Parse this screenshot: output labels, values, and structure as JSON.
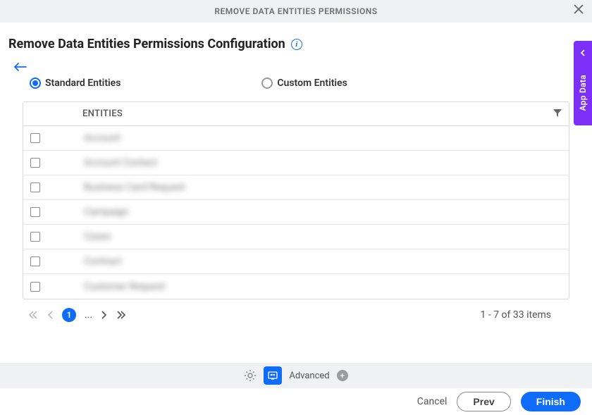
{
  "header": {
    "title": "REMOVE DATA ENTITIES PERMISSIONS"
  },
  "page": {
    "title": "Remove Data Entities Permissions Configuration"
  },
  "radios": {
    "standard": "Standard Entities",
    "custom": "Custom Entities"
  },
  "table": {
    "header": "ENTITIES",
    "rows": [
      "Account",
      "Account Contact",
      "Business Card Request",
      "Campaign",
      "Cases",
      "Contract",
      "Customer Request"
    ]
  },
  "pagination": {
    "current": "1",
    "more": "...",
    "summary": "1 - 7 of 33 items"
  },
  "footer": {
    "advanced": "Advanced"
  },
  "actions": {
    "cancel": "Cancel",
    "prev": "Prev",
    "finish": "Finish"
  },
  "sidetab": {
    "label": "App Data"
  }
}
